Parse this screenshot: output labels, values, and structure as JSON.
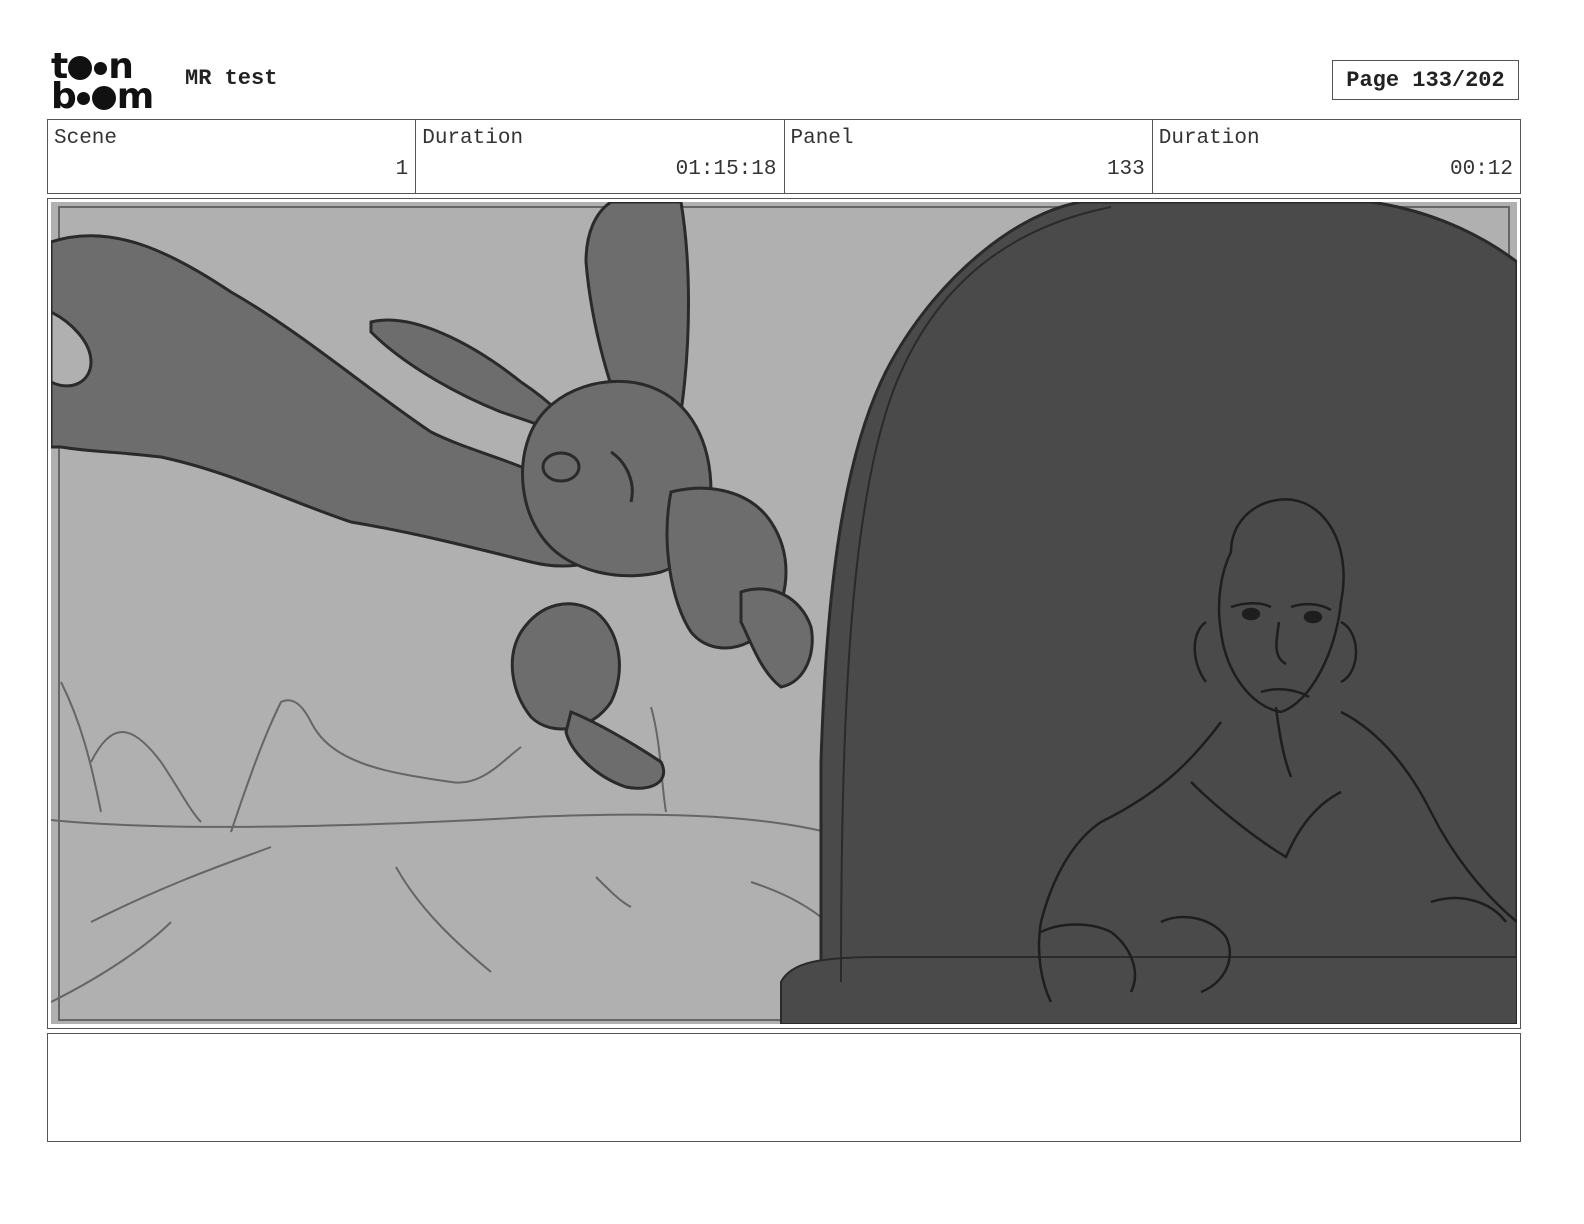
{
  "header": {
    "logo": {
      "line1": "toon",
      "line2": "boom"
    },
    "project_title": "MR test",
    "page_label": "Page 133/202"
  },
  "info": {
    "scene_label": "Scene",
    "scene_value": "1",
    "scene_duration_label": "Duration",
    "scene_duration_value": "01:15:18",
    "panel_label": "Panel",
    "panel_value": "133",
    "panel_duration_label": "Duration",
    "panel_duration_value": "00:12"
  },
  "panel_image": {
    "description_icon": "storyboard-sketch",
    "colors": {
      "background": "#b0b0b0",
      "dark_shape": "#4a4a4a",
      "mid_shape": "#6d6d6d",
      "line": "#2a2a2a"
    }
  },
  "notes": {
    "text": ""
  }
}
